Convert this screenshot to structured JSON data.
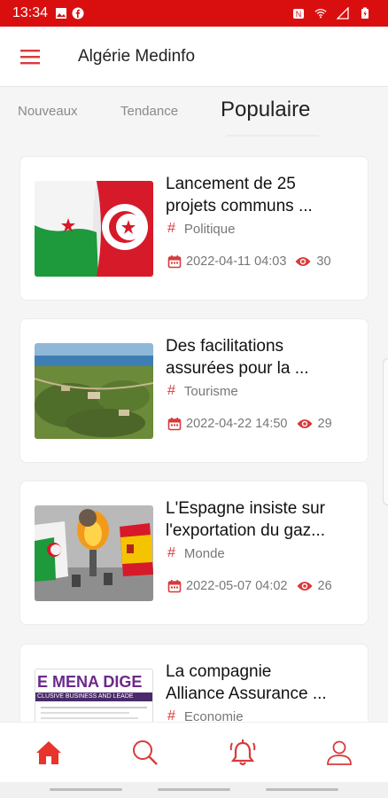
{
  "status": {
    "time": "13:34"
  },
  "app": {
    "title": "Algérie Medinfo"
  },
  "tabs": [
    {
      "label": "Nouveaux"
    },
    {
      "label": "Tendance"
    },
    {
      "label": "Populaire"
    }
  ],
  "articles": [
    {
      "title_l1": "Lancement de 25",
      "title_l2": "projets communs ...",
      "category": "Politique",
      "date": "2022-04-11 04:03",
      "views": "30"
    },
    {
      "title_l1": "Des facilitations",
      "title_l2": "assurées pour la ...",
      "category": "Tourisme",
      "date": "2022-04-22 14:50",
      "views": "29"
    },
    {
      "title_l1": "L'Espagne insiste sur",
      "title_l2": "l'exportation du gaz...",
      "category": "Monde",
      "date": "2022-05-07 04:02",
      "views": "26"
    },
    {
      "title_l1": "La compagnie",
      "title_l2": "Alliance Assurance ...",
      "category": "Economie",
      "thumb_text_1": "E MENA DIGE",
      "thumb_text_2": "CLUSIVE BUSINESS AND LEADE"
    }
  ],
  "colors": {
    "accent": "#d90f0f",
    "icon_red": "#d93a3a"
  }
}
